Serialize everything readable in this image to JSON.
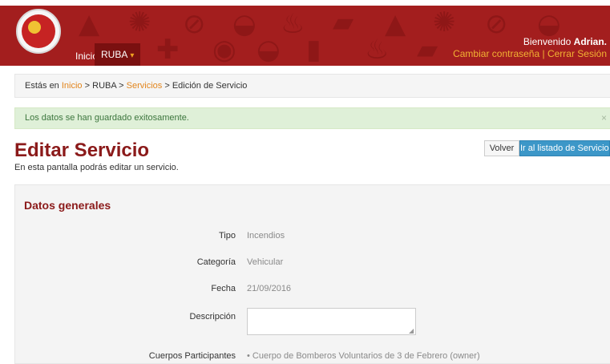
{
  "header": {
    "nav": {
      "inicio_label": "Inicio",
      "ruba_label": "RUBA"
    },
    "welcome_prefix": "Bienvenido",
    "user_name": "Adrian.",
    "change_password_label": "Cambiar contraseña",
    "separator": "|",
    "logout_label": "Cerrar Sesión",
    "brand_color": "#a31e1e",
    "link_color": "#f2b233"
  },
  "breadcrumb": {
    "prefix": "Estás en",
    "home": "Inicio",
    "sep": ">",
    "section": "RUBA",
    "services": "Servicios",
    "current": "Edición de Servicio"
  },
  "alert": {
    "message": "Los datos se han guardado exitosamente.",
    "close": "×",
    "color": "#dff0d8"
  },
  "page": {
    "title": "Editar Servicio",
    "subtitle": "En esta pantalla podrás editar un servicio.",
    "back_button": "Volver",
    "list_button": "Ir al listado de Servicios"
  },
  "form": {
    "section_title": "Datos generales",
    "fields": {
      "tipo": {
        "label": "Tipo",
        "value": "Incendios"
      },
      "categoria": {
        "label": "Categoría",
        "value": "Vehicular"
      },
      "fecha": {
        "label": "Fecha",
        "value": "21/09/2016"
      },
      "descripcion": {
        "label": "Descripción",
        "value": ""
      },
      "cuerpos": {
        "label": "Cuerpos Participantes",
        "value": "•  Cuerpo de Bomberos Voluntarios de 3 de Febrero (owner)"
      }
    }
  },
  "icons": [
    "hydrant-icon",
    "fire-icon",
    "no-smoking-icon",
    "fire-truck-icon",
    "extinguisher-icon",
    "helmet-icon",
    "first-aid-icon",
    "alarm-icon"
  ]
}
